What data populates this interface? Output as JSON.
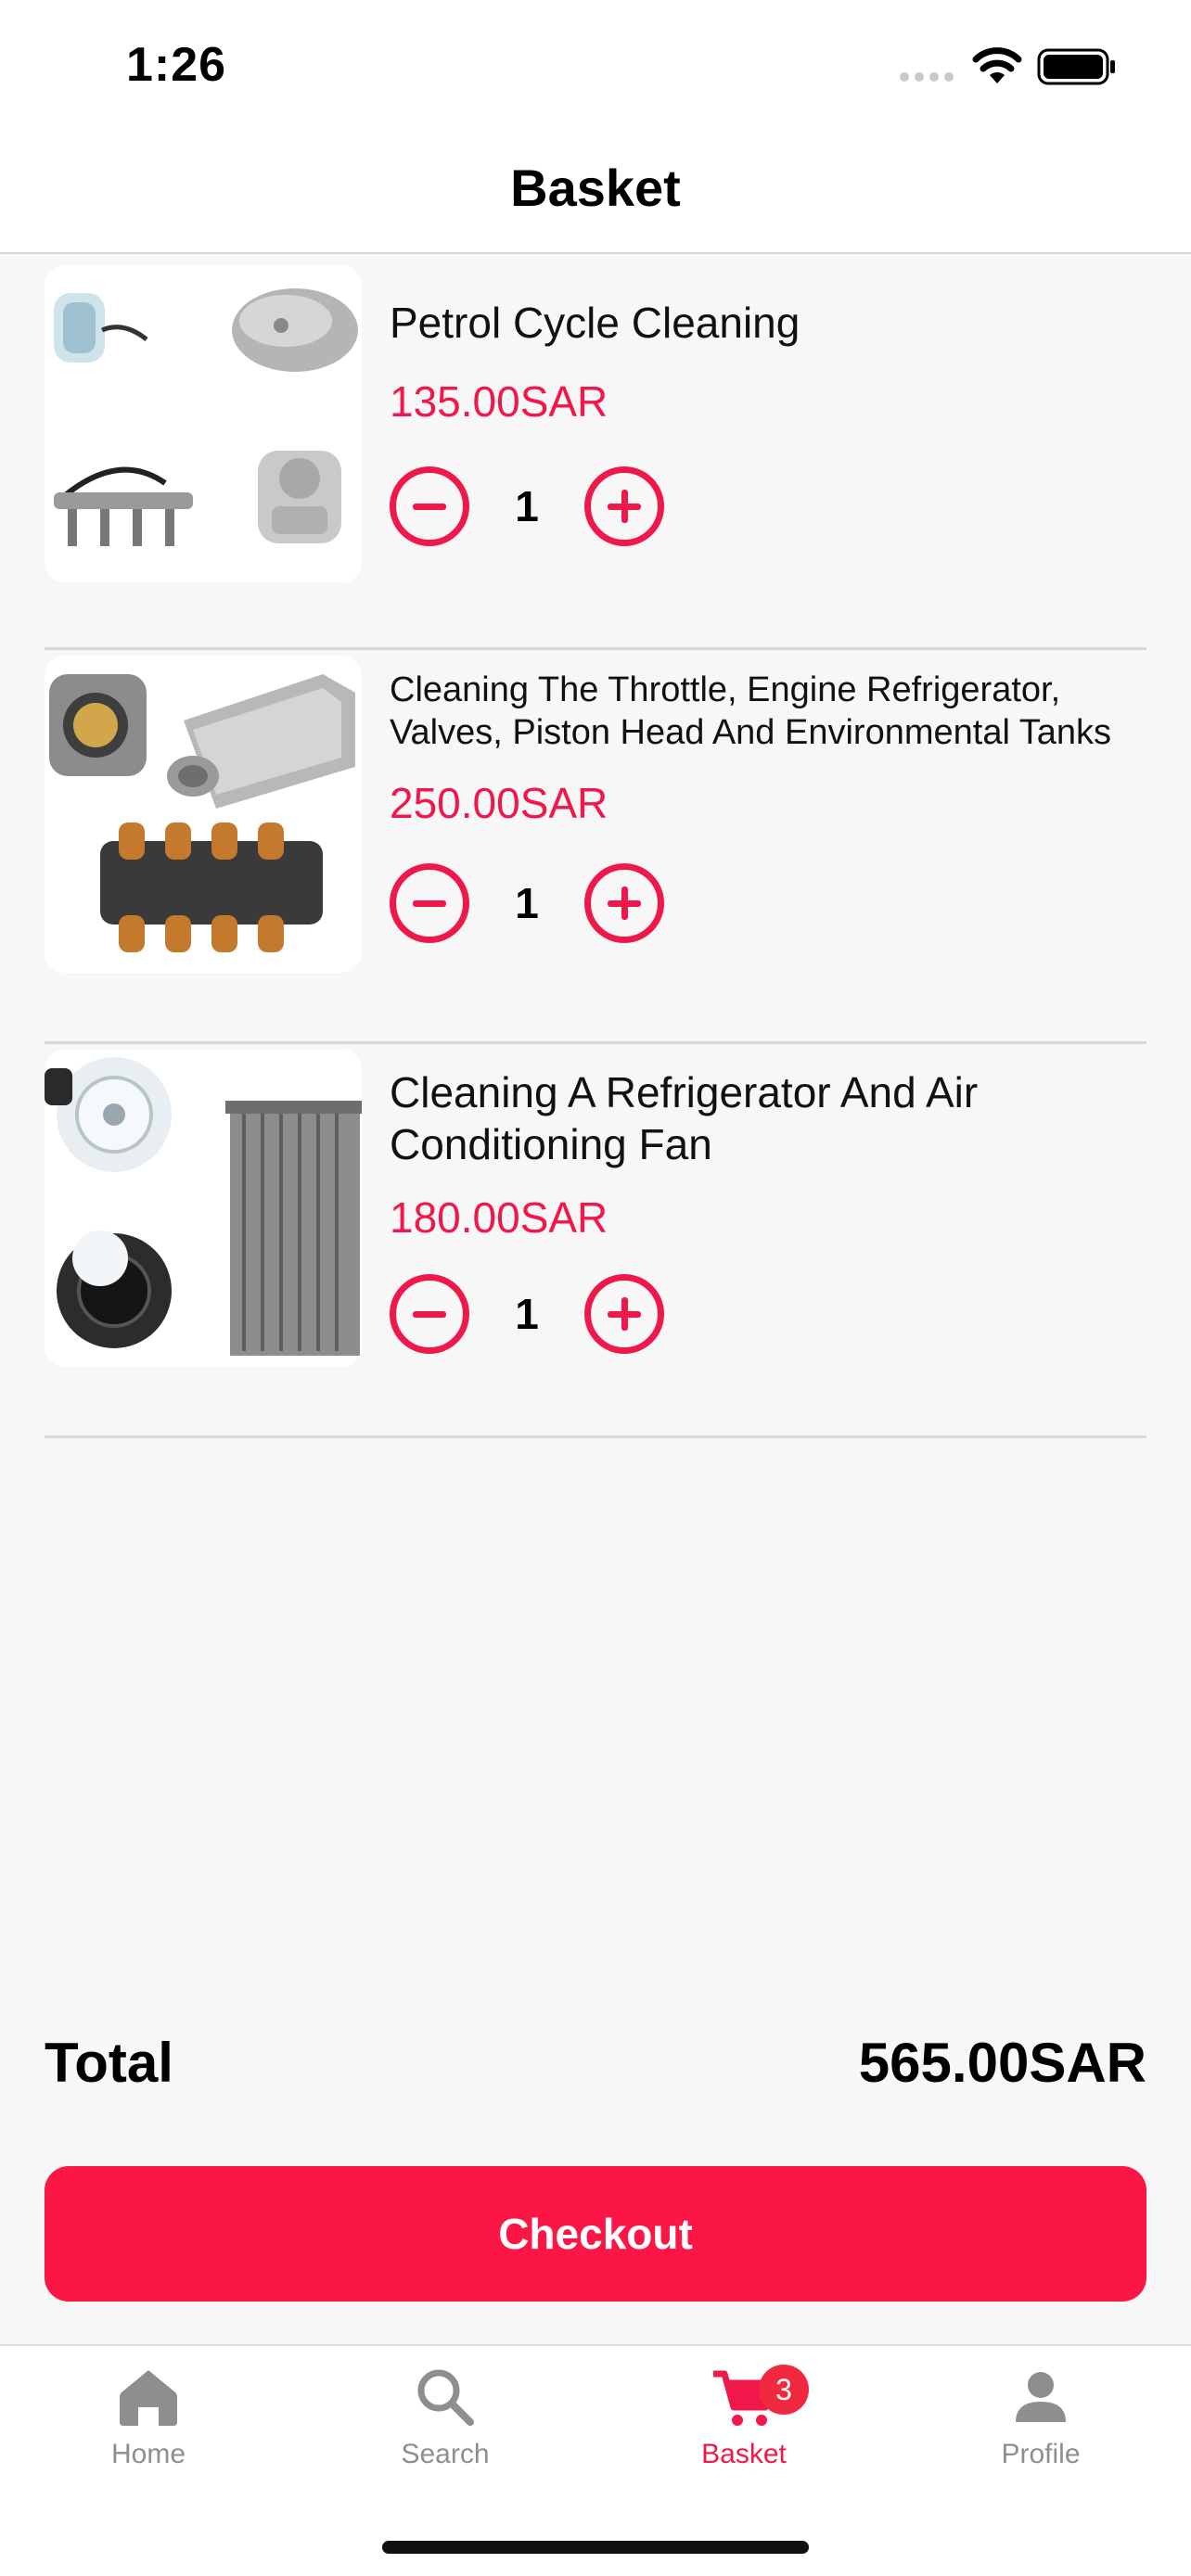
{
  "status_bar": {
    "time": "1:26"
  },
  "header": {
    "title": "Basket"
  },
  "cart": {
    "items": [
      {
        "name": "Petrol Cycle Cleaning",
        "price": "135.00SAR",
        "quantity": "1",
        "image": "fuel-system-parts"
      },
      {
        "name": "Cleaning The Throttle, Engine Refrigerator, Valves, Piston Head And Environmental Tanks",
        "price": "250.00SAR",
        "quantity": "1",
        "image": "throttle-intake-parts"
      },
      {
        "name": "Cleaning A Refrigerator And Air Conditioning Fan",
        "price": "180.00SAR",
        "quantity": "1",
        "image": "ac-fan-parts"
      }
    ]
  },
  "summary": {
    "total_label": "Total",
    "total_value": "565.00SAR"
  },
  "checkout": {
    "label": "Checkout"
  },
  "tab_bar": {
    "tabs": [
      {
        "label": "Home",
        "icon": "home-icon"
      },
      {
        "label": "Search",
        "icon": "search-icon"
      },
      {
        "label": "Basket",
        "icon": "cart-icon",
        "badge": "3",
        "active": true
      },
      {
        "label": "Profile",
        "icon": "person-icon"
      }
    ]
  },
  "colors": {
    "accent": "#f0174a",
    "button": "#fc1646",
    "inactive": "#8e8e8e"
  }
}
